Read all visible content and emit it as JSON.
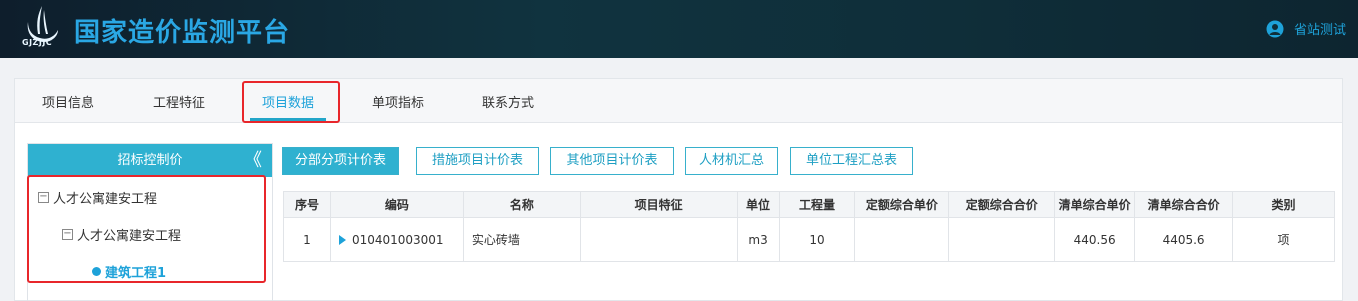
{
  "header": {
    "app_title": "国家造价监测平台",
    "logo_text": "GJZJJC",
    "user_name": "省站测试"
  },
  "tabs": [
    {
      "label": "项目信息"
    },
    {
      "label": "工程特征"
    },
    {
      "label": "项目数据",
      "active": true
    },
    {
      "label": "单项指标"
    },
    {
      "label": "联系方式"
    }
  ],
  "tree": {
    "title": "招标控制价",
    "collapse_symbol": "《",
    "nodes": [
      {
        "label": "人才公寓建安工程",
        "toggle": "−"
      },
      {
        "label": "人才公寓建安工程",
        "toggle": "−"
      },
      {
        "label": "建筑工程1"
      }
    ]
  },
  "buttons": [
    {
      "label": "分部分项计价表",
      "primary": true
    },
    {
      "label": "措施项目计价表"
    },
    {
      "label": "其他项目计价表"
    },
    {
      "label": "人材机汇总"
    },
    {
      "label": "单位工程汇总表"
    }
  ],
  "table": {
    "columns": [
      "序号",
      "编码",
      "名称",
      "项目特征",
      "单位",
      "工程量",
      "定额综合单价",
      "定额综合合价",
      "清单综合单价",
      "清单综合合价",
      "类别"
    ],
    "rows": [
      [
        "1",
        "010401003001",
        "实心砖墙",
        "",
        "m3",
        "10",
        "",
        "",
        "440.56",
        "4405.6",
        "项"
      ]
    ]
  },
  "colors": {
    "accent": "#2fb1d0",
    "highlight": "#e8262b",
    "title": "#2aa7e4"
  }
}
